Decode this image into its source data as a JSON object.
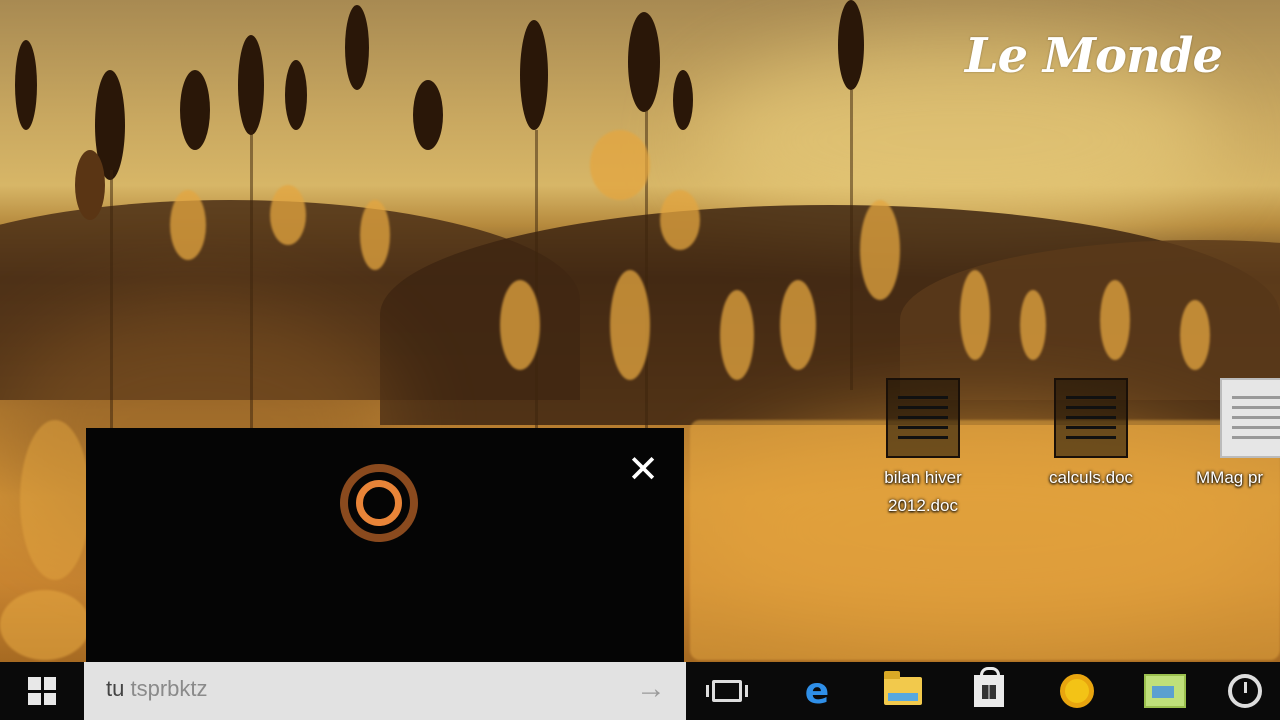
{
  "branding": {
    "logo_text": "Le Monde"
  },
  "desktop": {
    "icons": [
      {
        "label": "bilan hiver 2012.doc",
        "icon": "word-document-icon"
      },
      {
        "label": "calculs.doc",
        "icon": "word-document-icon"
      },
      {
        "label": "MMag pr",
        "icon": "document-icon"
      }
    ]
  },
  "cortana": {
    "close_symbol": "✕",
    "ring_outer_color": "#8a4a1e",
    "ring_inner_color": "#e88438"
  },
  "taskbar": {
    "search": {
      "typed_text": "tu",
      "suggestion_text": "tsprbktz",
      "submit_symbol": "→"
    },
    "pinned": [
      {
        "name": "task-view-icon"
      },
      {
        "name": "edge-icon",
        "glyph": "e"
      },
      {
        "name": "file-explorer-icon"
      },
      {
        "name": "store-icon"
      },
      {
        "name": "chrome-icon"
      },
      {
        "name": "photos-icon"
      },
      {
        "name": "clock-icon"
      }
    ]
  }
}
